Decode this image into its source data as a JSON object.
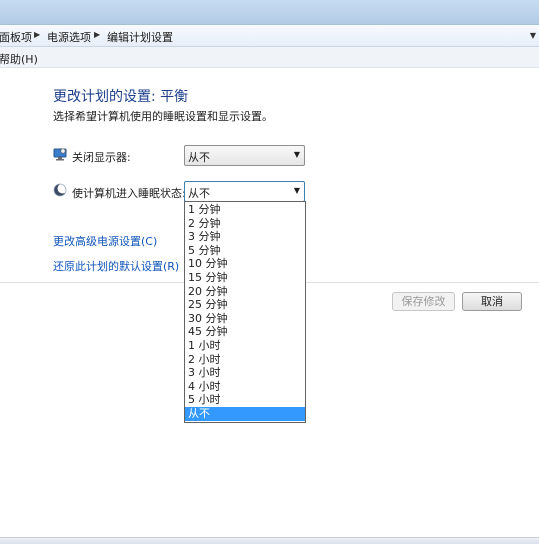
{
  "breadcrumb": {
    "items": [
      "面板项",
      "电源选项",
      "编辑计划设置"
    ]
  },
  "menu": {
    "help": "帮助(H)"
  },
  "page": {
    "heading": "更改计划的设置: 平衡",
    "subtext": "选择希望计算机使用的睡眠设置和显示设置。"
  },
  "settings": {
    "display_off": {
      "label": "关闭显示器:",
      "value": "从不"
    },
    "sleep": {
      "label": "使计算机进入睡眠状态:",
      "value": "从不"
    }
  },
  "links": {
    "advanced": "更改高级电源设置(C)",
    "restore": "还原此计划的默认设置(R)"
  },
  "buttons": {
    "save": "保存修改",
    "cancel": "取消"
  },
  "dropdown": {
    "options": [
      "1 分钟",
      "2 分钟",
      "3 分钟",
      "5 分钟",
      "10 分钟",
      "15 分钟",
      "20 分钟",
      "25 分钟",
      "30 分钟",
      "45 分钟",
      "1 小时",
      "2 小时",
      "3 小时",
      "4 小时",
      "5 小时",
      "从不"
    ],
    "selected_index": 15
  },
  "colors": {
    "heading": "#1e3e8c",
    "link": "#1155bb",
    "selection": "#3399ff"
  }
}
